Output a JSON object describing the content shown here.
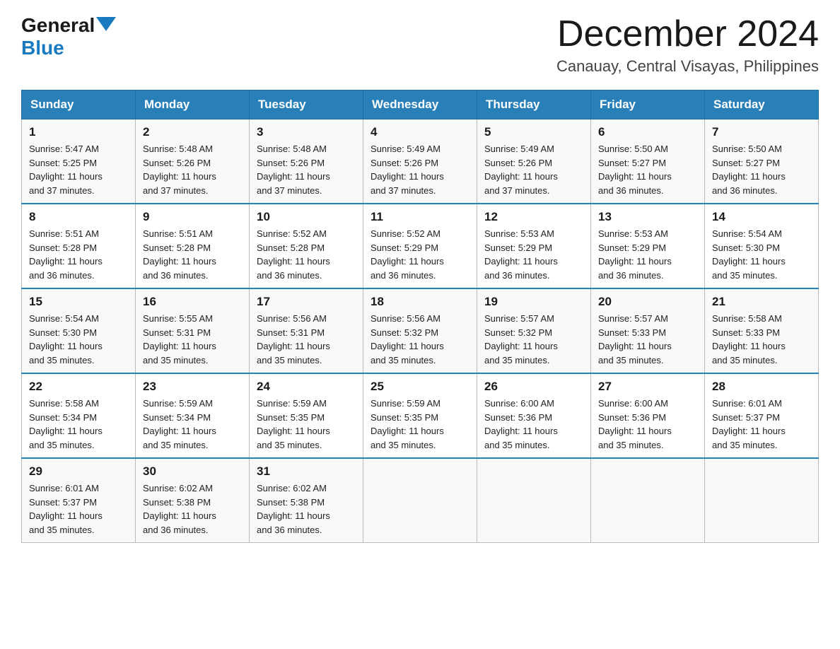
{
  "header": {
    "logo_general": "General",
    "logo_blue": "Blue",
    "month_title": "December 2024",
    "location": "Canauay, Central Visayas, Philippines"
  },
  "weekdays": [
    "Sunday",
    "Monday",
    "Tuesday",
    "Wednesday",
    "Thursday",
    "Friday",
    "Saturday"
  ],
  "weeks": [
    [
      {
        "day": "1",
        "sunrise": "5:47 AM",
        "sunset": "5:25 PM",
        "daylight": "11 hours and 37 minutes."
      },
      {
        "day": "2",
        "sunrise": "5:48 AM",
        "sunset": "5:26 PM",
        "daylight": "11 hours and 37 minutes."
      },
      {
        "day": "3",
        "sunrise": "5:48 AM",
        "sunset": "5:26 PM",
        "daylight": "11 hours and 37 minutes."
      },
      {
        "day": "4",
        "sunrise": "5:49 AM",
        "sunset": "5:26 PM",
        "daylight": "11 hours and 37 minutes."
      },
      {
        "day": "5",
        "sunrise": "5:49 AM",
        "sunset": "5:26 PM",
        "daylight": "11 hours and 37 minutes."
      },
      {
        "day": "6",
        "sunrise": "5:50 AM",
        "sunset": "5:27 PM",
        "daylight": "11 hours and 36 minutes."
      },
      {
        "day": "7",
        "sunrise": "5:50 AM",
        "sunset": "5:27 PM",
        "daylight": "11 hours and 36 minutes."
      }
    ],
    [
      {
        "day": "8",
        "sunrise": "5:51 AM",
        "sunset": "5:28 PM",
        "daylight": "11 hours and 36 minutes."
      },
      {
        "day": "9",
        "sunrise": "5:51 AM",
        "sunset": "5:28 PM",
        "daylight": "11 hours and 36 minutes."
      },
      {
        "day": "10",
        "sunrise": "5:52 AM",
        "sunset": "5:28 PM",
        "daylight": "11 hours and 36 minutes."
      },
      {
        "day": "11",
        "sunrise": "5:52 AM",
        "sunset": "5:29 PM",
        "daylight": "11 hours and 36 minutes."
      },
      {
        "day": "12",
        "sunrise": "5:53 AM",
        "sunset": "5:29 PM",
        "daylight": "11 hours and 36 minutes."
      },
      {
        "day": "13",
        "sunrise": "5:53 AM",
        "sunset": "5:29 PM",
        "daylight": "11 hours and 36 minutes."
      },
      {
        "day": "14",
        "sunrise": "5:54 AM",
        "sunset": "5:30 PM",
        "daylight": "11 hours and 35 minutes."
      }
    ],
    [
      {
        "day": "15",
        "sunrise": "5:54 AM",
        "sunset": "5:30 PM",
        "daylight": "11 hours and 35 minutes."
      },
      {
        "day": "16",
        "sunrise": "5:55 AM",
        "sunset": "5:31 PM",
        "daylight": "11 hours and 35 minutes."
      },
      {
        "day": "17",
        "sunrise": "5:56 AM",
        "sunset": "5:31 PM",
        "daylight": "11 hours and 35 minutes."
      },
      {
        "day": "18",
        "sunrise": "5:56 AM",
        "sunset": "5:32 PM",
        "daylight": "11 hours and 35 minutes."
      },
      {
        "day": "19",
        "sunrise": "5:57 AM",
        "sunset": "5:32 PM",
        "daylight": "11 hours and 35 minutes."
      },
      {
        "day": "20",
        "sunrise": "5:57 AM",
        "sunset": "5:33 PM",
        "daylight": "11 hours and 35 minutes."
      },
      {
        "day": "21",
        "sunrise": "5:58 AM",
        "sunset": "5:33 PM",
        "daylight": "11 hours and 35 minutes."
      }
    ],
    [
      {
        "day": "22",
        "sunrise": "5:58 AM",
        "sunset": "5:34 PM",
        "daylight": "11 hours and 35 minutes."
      },
      {
        "day": "23",
        "sunrise": "5:59 AM",
        "sunset": "5:34 PM",
        "daylight": "11 hours and 35 minutes."
      },
      {
        "day": "24",
        "sunrise": "5:59 AM",
        "sunset": "5:35 PM",
        "daylight": "11 hours and 35 minutes."
      },
      {
        "day": "25",
        "sunrise": "5:59 AM",
        "sunset": "5:35 PM",
        "daylight": "11 hours and 35 minutes."
      },
      {
        "day": "26",
        "sunrise": "6:00 AM",
        "sunset": "5:36 PM",
        "daylight": "11 hours and 35 minutes."
      },
      {
        "day": "27",
        "sunrise": "6:00 AM",
        "sunset": "5:36 PM",
        "daylight": "11 hours and 35 minutes."
      },
      {
        "day": "28",
        "sunrise": "6:01 AM",
        "sunset": "5:37 PM",
        "daylight": "11 hours and 35 minutes."
      }
    ],
    [
      {
        "day": "29",
        "sunrise": "6:01 AM",
        "sunset": "5:37 PM",
        "daylight": "11 hours and 35 minutes."
      },
      {
        "day": "30",
        "sunrise": "6:02 AM",
        "sunset": "5:38 PM",
        "daylight": "11 hours and 36 minutes."
      },
      {
        "day": "31",
        "sunrise": "6:02 AM",
        "sunset": "5:38 PM",
        "daylight": "11 hours and 36 minutes."
      },
      null,
      null,
      null,
      null
    ]
  ],
  "labels": {
    "sunrise": "Sunrise:",
    "sunset": "Sunset:",
    "daylight": "Daylight:"
  }
}
